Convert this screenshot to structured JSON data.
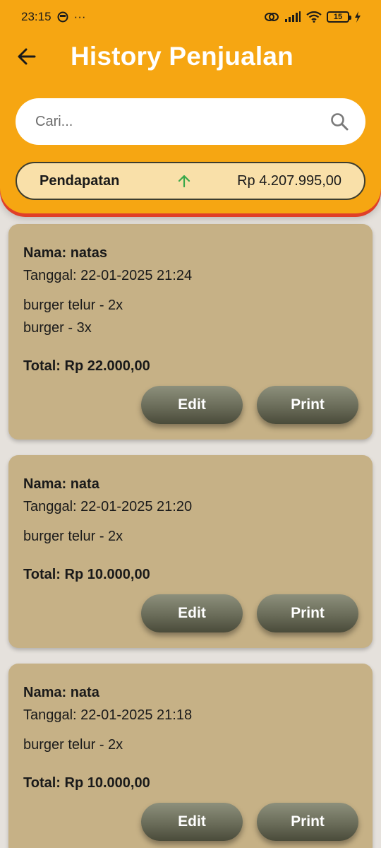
{
  "status_bar": {
    "time": "23:15",
    "more": "···",
    "battery": "15"
  },
  "appbar": {
    "title": "History Penjualan"
  },
  "search": {
    "placeholder": "Cari...",
    "value": ""
  },
  "income": {
    "label": "Pendapatan",
    "value": "Rp 4.207.995,00",
    "trend": "up",
    "trend_color": "#3aa84a"
  },
  "transactions": [
    {
      "name": "Nama: natas",
      "date": "Tanggal: 22-01-2025 21:24",
      "items": [
        "burger telur - 2x",
        "burger - 3x"
      ],
      "total": "Total: Rp 22.000,00",
      "edit_label": "Edit",
      "print_label": "Print"
    },
    {
      "name": "Nama: nata",
      "date": "Tanggal: 22-01-2025 21:20",
      "items": [
        "burger telur - 2x"
      ],
      "total": "Total: Rp 10.000,00",
      "edit_label": "Edit",
      "print_label": "Print"
    },
    {
      "name": "Nama: nata",
      "date": "Tanggal: 22-01-2025 21:18",
      "items": [
        "burger telur - 2x"
      ],
      "total": "Total: Rp 10.000,00",
      "edit_label": "Edit",
      "print_label": "Print"
    }
  ],
  "colors": {
    "header": "#f6a612",
    "header_edge": "#e03f28",
    "card": "#c6b186",
    "income_bg": "#f9e0a9",
    "button": "#6a6c59"
  }
}
